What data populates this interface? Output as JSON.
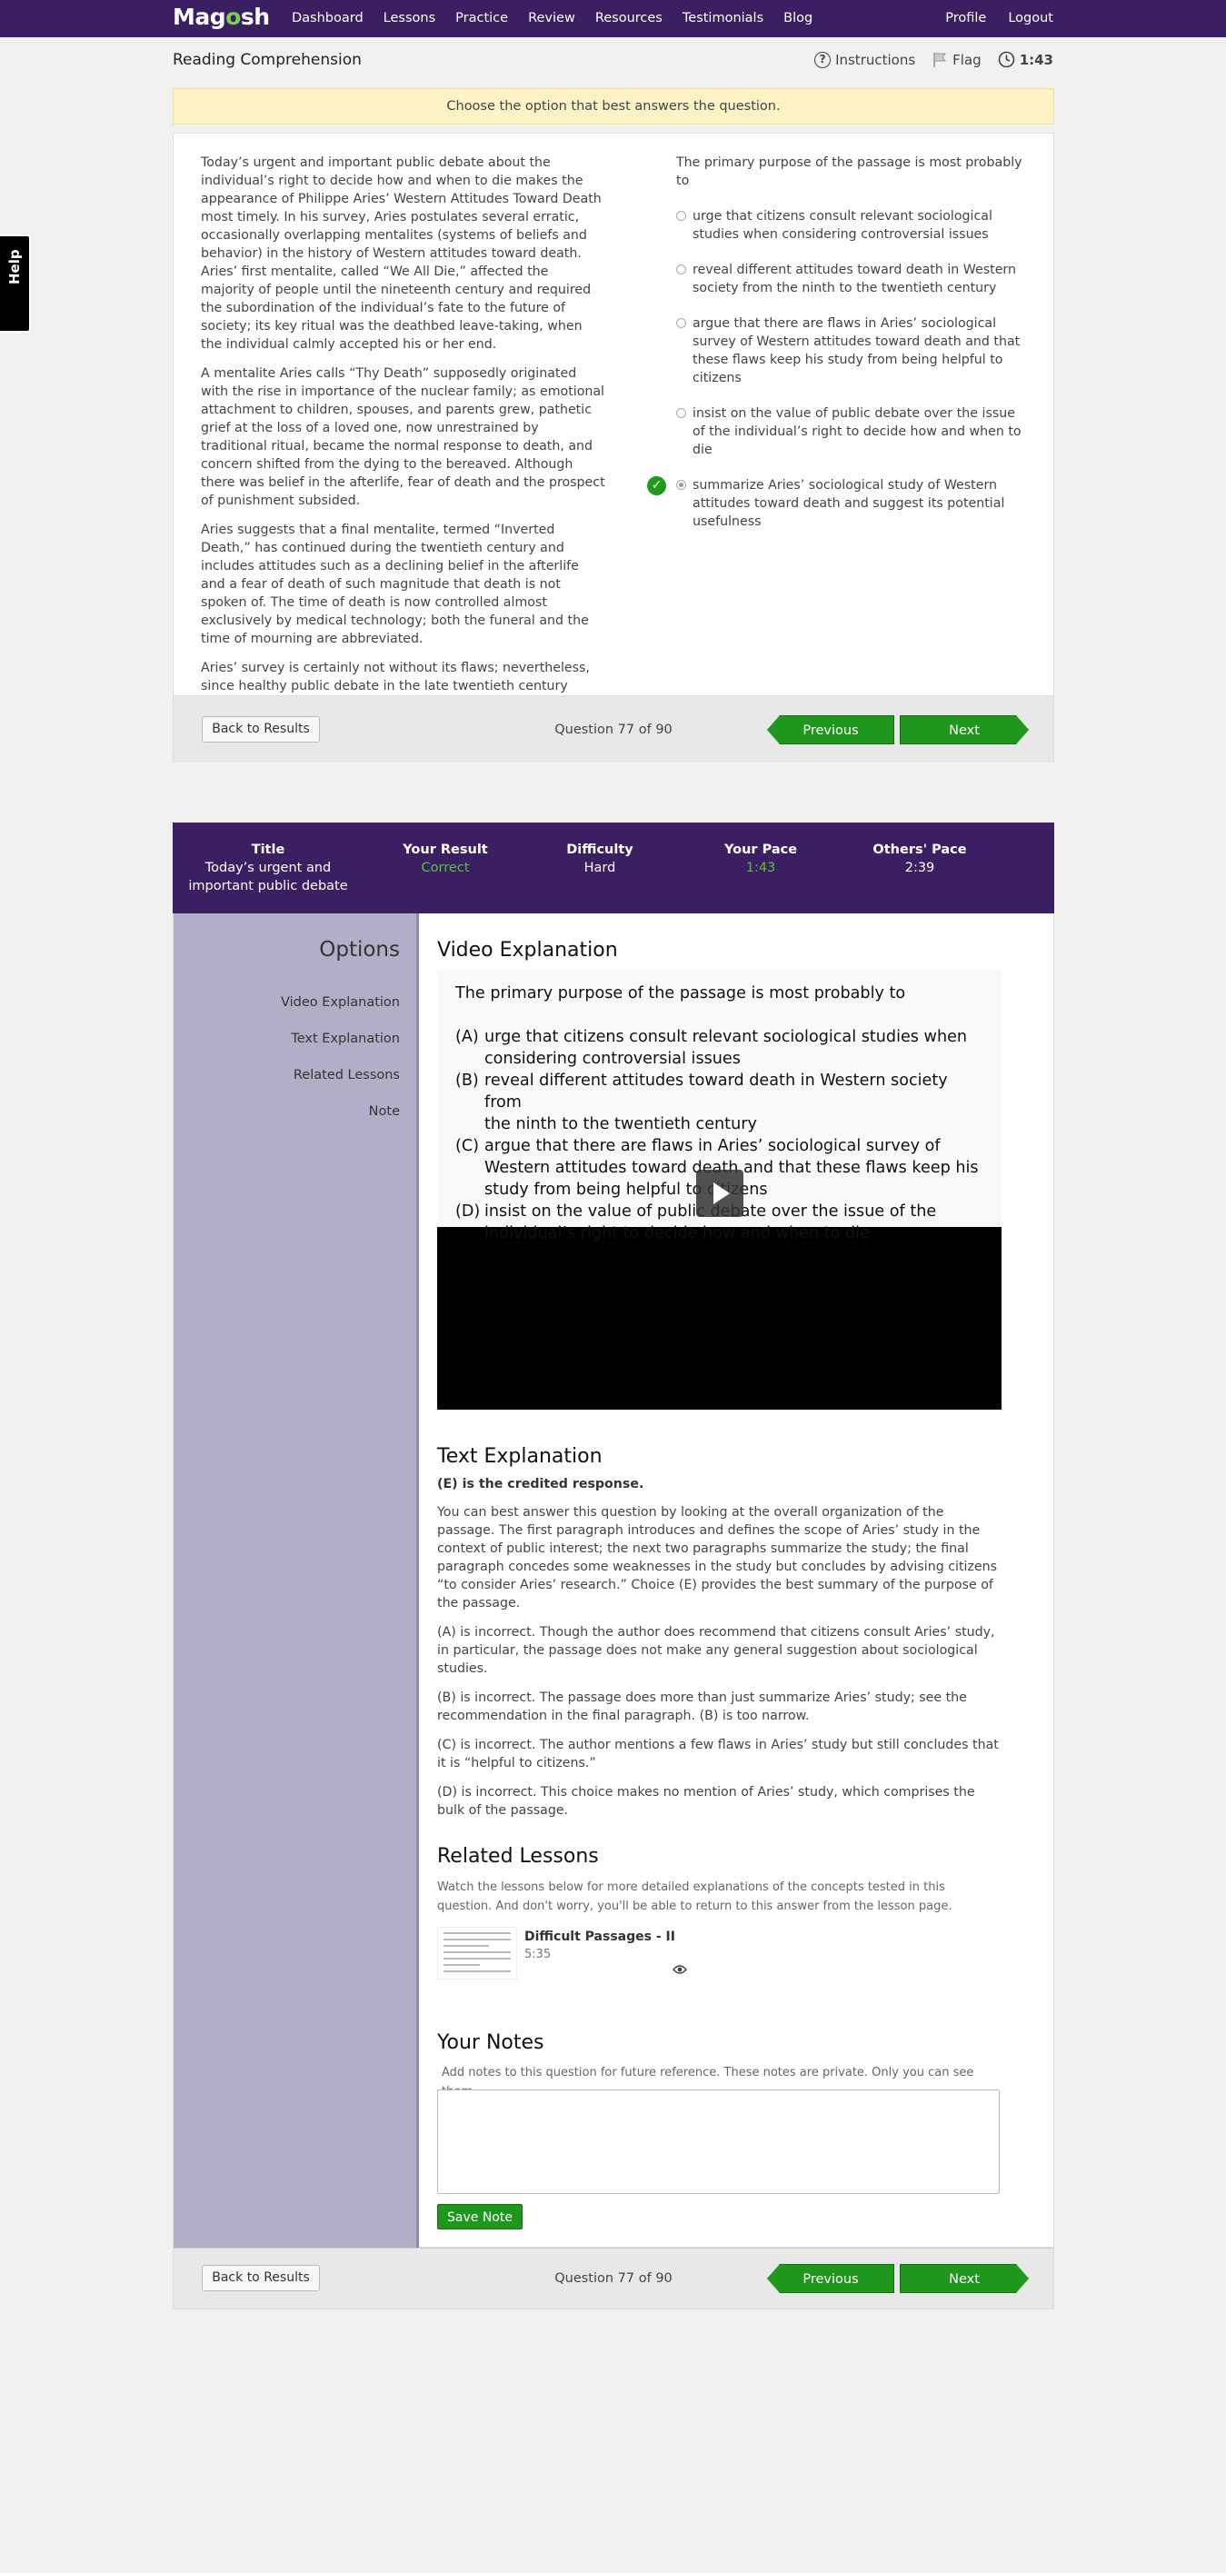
{
  "nav": {
    "logo_pre": "Mag",
    "logo_o": "o",
    "logo_post": "sh",
    "links": [
      "Dashboard",
      "Lessons",
      "Practice",
      "Review",
      "Resources",
      "Testimonials",
      "Blog"
    ],
    "right": [
      "Profile",
      "Logout"
    ]
  },
  "help": "Help",
  "header": {
    "title": "Reading Comprehension",
    "instructions": "Instructions",
    "flag": "Flag",
    "time": "1:43"
  },
  "instruction_banner": "Choose the option that best answers the question.",
  "passage": [
    "Today’s urgent and important public debate about the individual’s right to decide how and when to die makes the appearance of Philippe Aries’ Western Attitudes Toward Death most timely. In his survey, Aries postulates several erratic, occasionally overlapping mentalites (systems of beliefs and behavior) in the history of Western attitudes toward death. Aries’ first mentalite, called “We All Die,” affected the majority of people until the nineteenth century and required the subordination of the individual’s fate to the future of society; its key ritual was the deathbed leave-taking, when the individual calmly accepted his or her end.",
    "A mentalite Aries calls “Thy Death” supposedly originated with the rise in importance of the nuclear family; as emotional attachment to children, spouses, and parents grew, pathetic grief at the loss of a loved one, now unrestrained by traditional ritual, became the normal response to death, and concern shifted from the dying to the bereaved. Although there was belief in the afterlife, fear of death and the prospect of punishment subsided.",
    "Aries suggests that a final mentalite, termed “Inverted Death,” has continued during the twentieth century and includes attitudes such as a declining belief in the afterlife and a fear of death of such magnitude that death is not spoken of. The time of death is now controlled almost exclusively by medical technology; both the funeral and the time of mourning are abbreviated.",
    "Aries’ survey is certainly not without its flaws; nevertheless, since healthy public debate in the late twentieth century about the uses of medical technology has made death, ironically, more openly discussed, citizens would do well to consider Aries’ research."
  ],
  "question": {
    "stem": "The primary purpose of the passage is most probably to",
    "options": [
      "urge that citizens consult relevant sociological studies when considering controversial issues",
      "reveal different attitudes toward death in Western society from the ninth to the twentieth century",
      "argue that there are flaws in Aries’ sociological survey of Western attitudes toward death and that these flaws keep his study from being helpful to citizens",
      "insist on the value of public debate over the issue of the individual’s right to decide how and when to die",
      "summarize Aries’ sociological study of Western attitudes toward death and suggest its potential usefulness"
    ],
    "selected_index": 4,
    "correct_index": 4
  },
  "footer": {
    "back": "Back to Results",
    "count": "Question 77 of 90",
    "previous": "Previous",
    "next": "Next"
  },
  "stats": {
    "title_label": "Title",
    "title_value": "Today’s urgent and important public debate",
    "result_label": "Your Result",
    "result_value": "Correct",
    "difficulty_label": "Difficulty",
    "difficulty_value": "Hard",
    "pace_label": "Your Pace",
    "pace_value": "1:43",
    "others_label": "Others' Pace",
    "others_value": "2:39",
    "colors": {
      "correct": "#56c138",
      "bar": "#3b1f63"
    }
  },
  "sidebar": {
    "title": "Options",
    "items": [
      "Video Explanation",
      "Text Explanation",
      "Related Lessons",
      "Note"
    ]
  },
  "video": {
    "heading": "Video Explanation",
    "stem": "The primary purpose of the passage is most probably to",
    "lines": [
      {
        "letter": "(A)",
        "text": "urge that citizens consult relevant sociological studies when"
      },
      {
        "letter": "",
        "text": "considering controversial issues"
      },
      {
        "letter": "(B)",
        "text": "reveal different attitudes toward death in Western society from"
      },
      {
        "letter": "",
        "text": "the ninth to the twentieth century"
      },
      {
        "letter": "(C)",
        "text": "argue that there are flaws in Aries’ sociological survey of"
      },
      {
        "letter": "",
        "text": "Western attitudes toward death and that these flaws keep his"
      },
      {
        "letter": "",
        "text": "study from being helpful to citizens"
      },
      {
        "letter": "(D)",
        "text": "insist on the value of public debate over the issue of the"
      },
      {
        "letter": "",
        "text": "individual’s right to decide how and when to die"
      }
    ]
  },
  "text_explanation": {
    "heading": "Text Explanation",
    "credited": "(E) is the credited response.",
    "paragraphs": [
      "You can best answer this question by looking at the overall organization of the passage. The first paragraph introduces and defines the scope of Aries’ study in the context of public interest; the next two paragraphs summarize the study; the final paragraph concedes some weaknesses in the study but concludes by advising citizens “to consider Aries’ research.” Choice (E) provides the best summary of the purpose of the passage.",
      "(A) is incorrect. Though the author does recommend that citizens consult Aries’ study, in particular, the passage does not make any general suggestion about sociological studies.",
      "(B) is incorrect. The passage does more than just summarize Aries’ study; see the recommendation in the final paragraph. (B) is too narrow.",
      "(C) is incorrect. The author mentions a few flaws in Aries’ study but still concludes that it is “helpful to citizens.”",
      "(D) is incorrect. This choice makes no mention of Aries’ study, which comprises the bulk of the passage."
    ]
  },
  "related": {
    "heading": "Related Lessons",
    "desc": "Watch the lessons below for more detailed explanations of the concepts tested in this question. And don't worry, you'll be able to return to this answer from the lesson page.",
    "lesson_title": "Difficult Passages - II",
    "lesson_time": "5:35"
  },
  "notes": {
    "heading": "Your Notes",
    "desc": "Add notes to this question for future reference. These notes are private. Only you can see them.",
    "value": "",
    "save": "Save Note"
  }
}
